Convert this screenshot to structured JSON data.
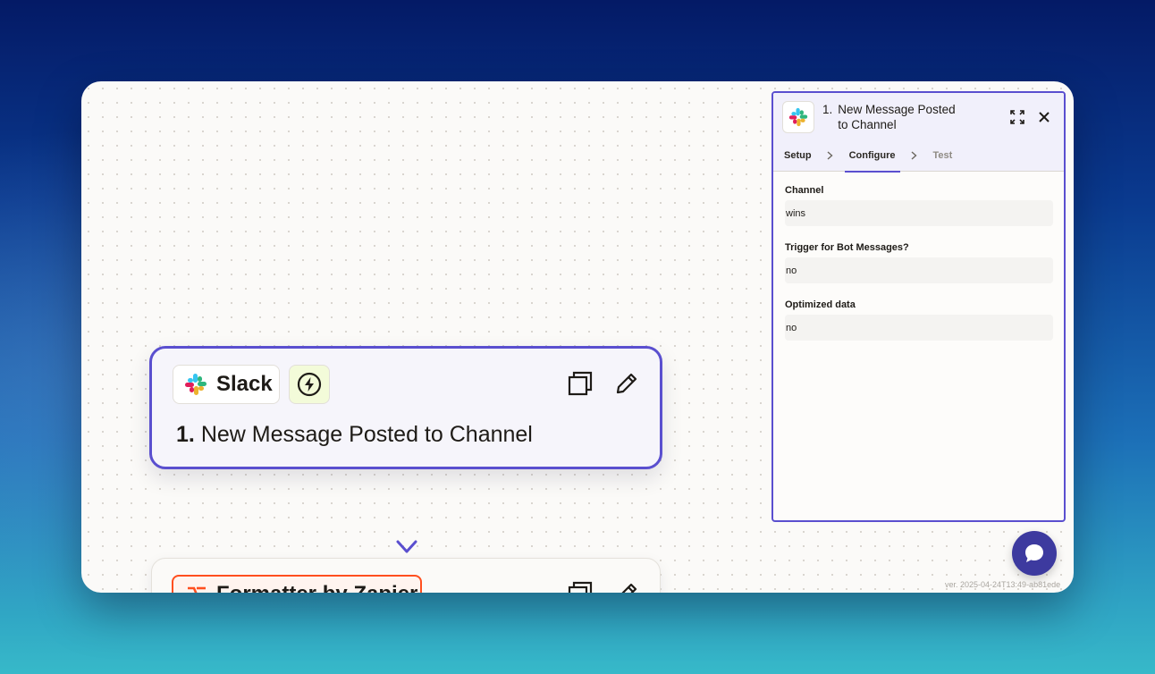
{
  "canvas": {
    "step1": {
      "app_name": "Slack",
      "trigger_icon": "lightning-bolt-icon",
      "step_number": "1.",
      "title": "New Message Posted to Channel"
    },
    "step2": {
      "app_name": "Formatter by Zapier"
    },
    "version": "ver. 2025-04-24T13:49-ab81ede"
  },
  "panel": {
    "step_number": "1.",
    "title": "New Message Posted to Channel",
    "tabs": [
      {
        "label": "Setup",
        "state": "default"
      },
      {
        "label": "Configure",
        "state": "active"
      },
      {
        "label": "Test",
        "state": "disabled"
      }
    ],
    "fields": [
      {
        "label": "Channel",
        "value": "wins"
      },
      {
        "label": "Trigger for Bot Messages?",
        "value": "no"
      },
      {
        "label": "Optimized data",
        "value": "no"
      }
    ]
  },
  "colors": {
    "accent": "#5a4fcf",
    "formatter": "#ff4f1f",
    "chat_button": "#3d3a9f"
  }
}
